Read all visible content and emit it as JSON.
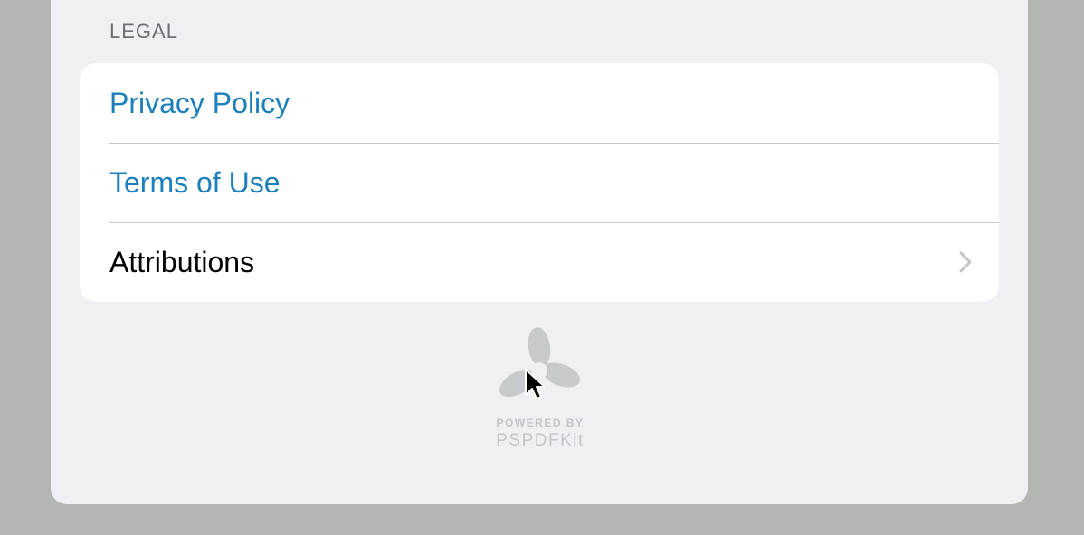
{
  "section": {
    "header": "LEGAL"
  },
  "rows": [
    {
      "label": "Privacy Policy",
      "style": "link"
    },
    {
      "label": "Terms of Use",
      "style": "link"
    },
    {
      "label": "Attributions",
      "style": "plain",
      "accessory": "chevron-right-icon"
    }
  ],
  "footer": {
    "powered_by": "POWERED BY",
    "brand": "PSPDFKit",
    "logo_icon": "pspdfkit-logo-icon"
  },
  "colors": {
    "link": "#1a7fba",
    "background": "#efeff4",
    "card": "#ffffff",
    "header_text": "#6d6d72",
    "separator": "#c6c6c8"
  }
}
